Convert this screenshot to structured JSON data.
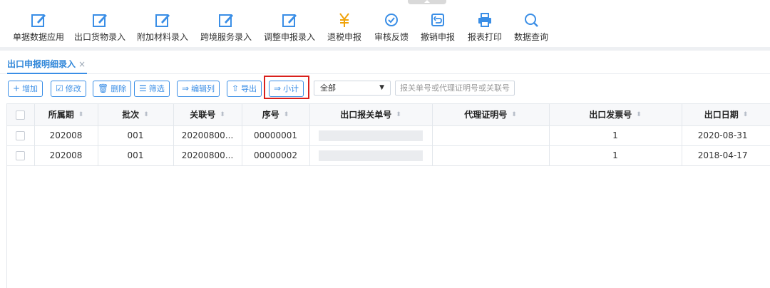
{
  "toolbar": {
    "items": [
      {
        "label": "单据数据应用",
        "icon": "edit-icon"
      },
      {
        "label": "出口货物录入",
        "icon": "edit-icon"
      },
      {
        "label": "附加材料录入",
        "icon": "edit-icon"
      },
      {
        "label": "跨境服务录入",
        "icon": "edit-icon"
      },
      {
        "label": "调整申报录入",
        "icon": "edit-icon"
      },
      {
        "label": "退税申报",
        "icon": "yen-icon"
      },
      {
        "label": "审核反馈",
        "icon": "check-circle-icon"
      },
      {
        "label": "撤销申报",
        "icon": "undo-icon"
      },
      {
        "label": "报表打印",
        "icon": "printer-icon"
      },
      {
        "label": "数据查询",
        "icon": "search-icon"
      }
    ]
  },
  "tabs": [
    {
      "label": "出口申报明细录入",
      "close": "×"
    }
  ],
  "actions": {
    "add": "增加",
    "edit": "修改",
    "delete": "删除",
    "filter": "筛选",
    "edit_columns": "编辑列",
    "export": "导出",
    "subtotal": "小计"
  },
  "filter_select": {
    "value": "全部"
  },
  "search": {
    "placeholder": "报关单号或代理证明号或关联号"
  },
  "table": {
    "columns": [
      "所属期",
      "批次",
      "关联号",
      "序号",
      "出口报关单号",
      "代理证明号",
      "出口发票号",
      "出口日期"
    ],
    "rows": [
      {
        "period": "202008",
        "batch": "001",
        "link_no": "20200800...",
        "seq": "00000001",
        "customs_no": "",
        "agent_no": "",
        "invoice_no": "1",
        "date": "2020-08-31"
      },
      {
        "period": "202008",
        "batch": "001",
        "link_no": "20200800...",
        "seq": "00000002",
        "customs_no": "",
        "agent_no": "",
        "invoice_no": "1",
        "date": "2018-04-17"
      }
    ]
  },
  "colors": {
    "accent": "#3a8ee6",
    "highlight": "#d9201c"
  }
}
